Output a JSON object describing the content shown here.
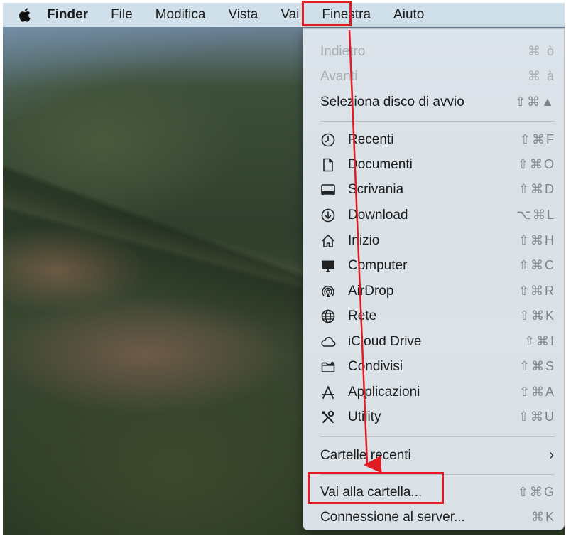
{
  "menubar": {
    "apple_icon": "apple-logo-icon",
    "items": [
      "Finder",
      "File",
      "Modifica",
      "Vista",
      "Vai",
      "Finestra",
      "Aiuto"
    ]
  },
  "menu": {
    "top_items": [
      {
        "label": "Indietro",
        "shortcut": "⌘ ò",
        "enabled": false
      },
      {
        "label": "Avanti",
        "shortcut": "⌘ à",
        "enabled": false
      },
      {
        "label": "Seleziona disco di avvio",
        "shortcut": "⇧⌘▲",
        "enabled": true
      }
    ],
    "places": [
      {
        "label": "Recenti",
        "shortcut": "⇧⌘F",
        "icon": "clock-icon"
      },
      {
        "label": "Documenti",
        "shortcut": "⇧⌘O",
        "icon": "document-icon"
      },
      {
        "label": "Scrivania",
        "shortcut": "⇧⌘D",
        "icon": "desktop-icon"
      },
      {
        "label": "Download",
        "shortcut": "⌥⌘L",
        "icon": "download-icon"
      },
      {
        "label": "Inizio",
        "shortcut": "⇧⌘H",
        "icon": "home-icon"
      },
      {
        "label": "Computer",
        "shortcut": "⇧⌘C",
        "icon": "monitor-icon"
      },
      {
        "label": "AirDrop",
        "shortcut": "⇧⌘R",
        "icon": "airdrop-icon"
      },
      {
        "label": "Rete",
        "shortcut": "⇧⌘K",
        "icon": "globe-icon"
      },
      {
        "label": "iCloud Drive",
        "shortcut": "⇧⌘I",
        "icon": "cloud-icon"
      },
      {
        "label": "Condivisi",
        "shortcut": "⇧⌘S",
        "icon": "shared-folder-icon"
      },
      {
        "label": "Applicazioni",
        "shortcut": "⇧⌘A",
        "icon": "applications-icon"
      },
      {
        "label": "Utility",
        "shortcut": "⇧⌘U",
        "icon": "tools-icon"
      }
    ],
    "recent_folders": {
      "label": "Cartelle recenti",
      "submenu_icon": "chevron-right-icon"
    },
    "go_to_folder": {
      "label": "Vai alla cartella...",
      "shortcut": "⇧⌘G"
    },
    "connect_server": {
      "label": "Connessione al server...",
      "shortcut": "⌘K"
    }
  },
  "colors": {
    "highlight_box": "#e01b24",
    "menu_bg": "#e0e7ee",
    "menubar_bg": "#cfe0ea",
    "disabled_text": "#a7adb3"
  }
}
